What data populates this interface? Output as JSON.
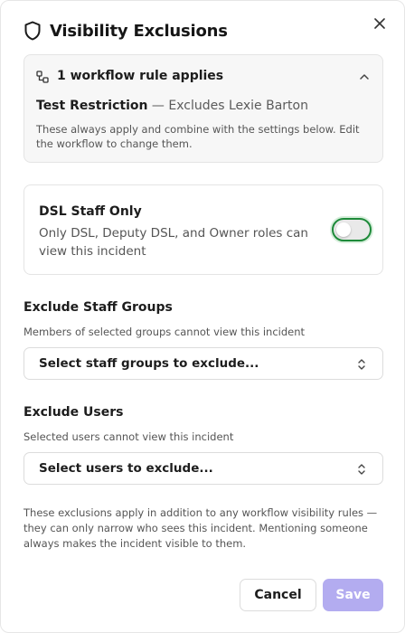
{
  "dialog": {
    "title": "Visibility Exclusions"
  },
  "workflow_rules": {
    "summary": "1 workflow rule applies",
    "rule_name": "Test Restriction",
    "rule_description": "— Excludes Lexie Barton",
    "note": "These always apply and combine with the settings below. Edit the workflow to change them.",
    "expanded": true
  },
  "dsl_staff_only": {
    "title": "DSL Staff Only",
    "description": "Only DSL, Deputy DSL, and Owner roles can view this incident",
    "enabled": false,
    "focus_color": "#1e8a3a"
  },
  "exclude_staff_groups": {
    "title": "Exclude Staff Groups",
    "subtitle": "Members of selected groups cannot view this incident",
    "placeholder": "Select staff groups to exclude..."
  },
  "exclude_users": {
    "title": "Exclude Users",
    "subtitle": "Selected users cannot view this incident",
    "placeholder": "Select users to exclude..."
  },
  "footnote": "These exclusions apply in addition to any workflow visibility rules — they can only narrow who sees this incident. Mentioning someone always makes the incident visible to them.",
  "actions": {
    "cancel_label": "Cancel",
    "save_label": "Save",
    "save_disabled": true,
    "save_color": "#b3acf0"
  },
  "icons": {
    "header": "shield-icon",
    "close": "close-icon",
    "workflow": "workflow-icon",
    "collapse": "chevron-up-icon",
    "select": "chevron-up-down-icon"
  }
}
